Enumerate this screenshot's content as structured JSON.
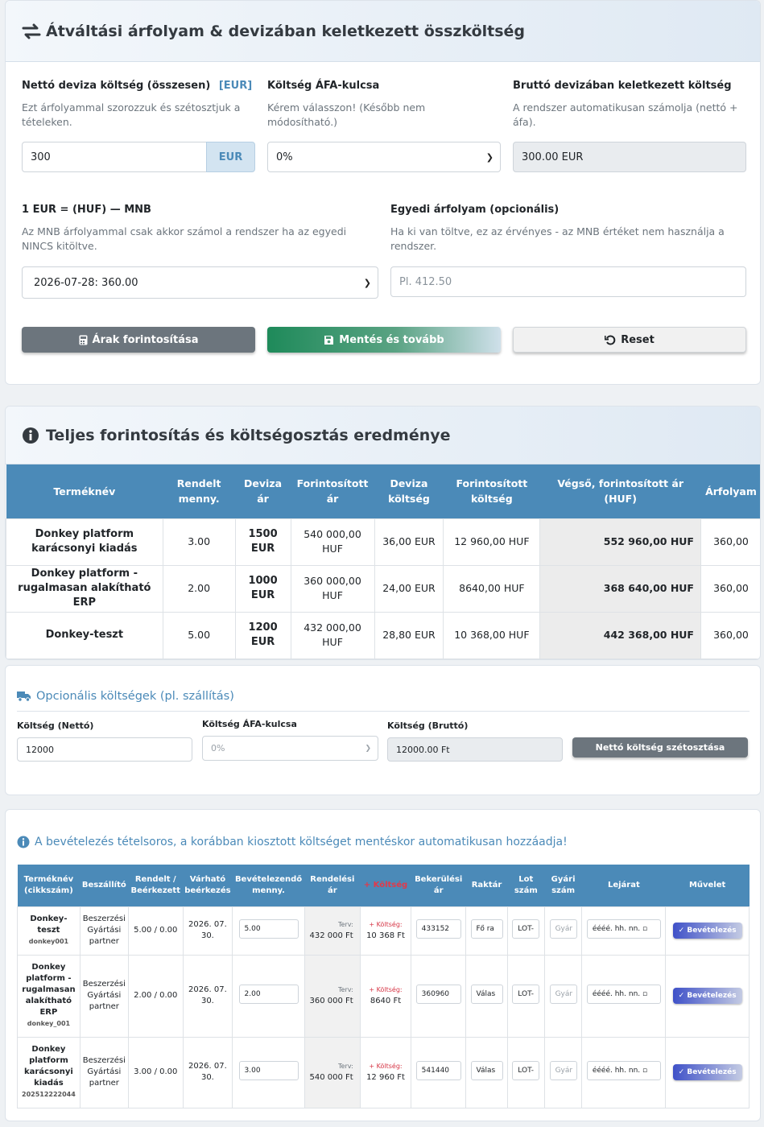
{
  "exchange": {
    "title": "Átváltási árfolyam & devizában keletkezett összköltség",
    "net_label": "Nettó deviza költség (összesen)",
    "net_currency_badge": "[EUR]",
    "net_hint": "Ezt árfolyammal szorozzuk és szétosztjuk a tételeken.",
    "net_value": "300",
    "net_addon": "EUR",
    "vat_label": "Költség ÁFA-kulcsa",
    "vat_hint": "Kérem válasszon! (Később nem módosítható.)",
    "vat_value": "0%",
    "gross_label": "Bruttó devizában keletkezett költség",
    "gross_hint": "A rendszer automatikusan számolja (nettó + áfa).",
    "gross_value": "300.00 EUR",
    "rate_label": "1 EUR = (HUF) — MNB",
    "rate_hint": "Az MNB árfolyammal csak akkor számol a rendszer ha az egyedi NINCS kitöltve.",
    "rate_value": "2026-07-28: 360.00",
    "custom_label": "Egyedi árfolyam (opcionális)",
    "custom_hint": "Ha ki van töltve, ez az érvényes - az MNB értéket nem használja a rendszer.",
    "custom_placeholder": "Pl. 412.50",
    "btn_convert": "Árak forintosítása",
    "btn_save": "Mentés és tovább",
    "btn_reset": "Reset"
  },
  "result": {
    "title": "Teljes forintosítás és költségosztás eredménye",
    "headers": [
      "Terméknév",
      "Rendelt menny.",
      "Deviza ár",
      "Forintosított ár",
      "Deviza költség",
      "Forintosított költség",
      "Végső, forintosított ár (HUF)",
      "Árfolyam"
    ],
    "rows": [
      {
        "name": "Donkey platform karácsonyi kiadás",
        "qty": "3.00",
        "fx_price": "1500 EUR",
        "huf_price": "540 000,00 HUF",
        "fx_cost": "36,00 EUR",
        "huf_cost": "12 960,00 HUF",
        "final": "552 960,00 HUF",
        "rate": "360,00"
      },
      {
        "name": "Donkey platform - rugalmasan alakítható ERP",
        "qty": "2.00",
        "fx_price": "1000 EUR",
        "huf_price": "360 000,00 HUF",
        "fx_cost": "24,00 EUR",
        "huf_cost": "8640,00 HUF",
        "final": "368 640,00 HUF",
        "rate": "360,00"
      },
      {
        "name": "Donkey-teszt",
        "qty": "5.00",
        "fx_price": "1200 EUR",
        "huf_price": "432 000,00 HUF",
        "fx_cost": "28,80 EUR",
        "huf_cost": "10 368,00 HUF",
        "final": "442 368,00 HUF",
        "rate": "360,00"
      }
    ]
  },
  "optional": {
    "title": "Opcionális költségek (pl. szállítás)",
    "net_label": "Költség (Nettó)",
    "net_value": "12000",
    "vat_label": "Költség ÁFA-kulcsa",
    "vat_value": "0%",
    "gross_label": "Költség (Bruttó)",
    "gross_value": "12000.00 Ft",
    "btn_distribute": "Nettó költség szétosztása"
  },
  "receiving": {
    "notice": "A bevételezés tételsoros, a korábban kiosztott költséget mentéskor automatikusan hozzáadja!",
    "headers": [
      "Terméknév (cikkszám)",
      "Beszállító",
      "Rendelt / Beérkezett",
      "Várható beérkezés",
      "Bevételezendő menny.",
      "Rendelési ár",
      "+ Költség",
      "Bekerülési ár",
      "Raktár",
      "Lot szám",
      "Gyári szám",
      "Lejárat",
      "Művelet"
    ],
    "rows": [
      {
        "name": "Donkey-teszt",
        "sku": "donkey001",
        "supplier": "Beszerzési Gyártási partner",
        "ordered": "5.00 / 0.00",
        "expected": "2026. 07. 30.",
        "qty": "5.00",
        "plan_label": "Terv:",
        "plan": "432 000 Ft",
        "cost_label": "+ Költség:",
        "cost": "10 368 Ft",
        "landed": "433152",
        "warehouse": "Fő ra",
        "lot": "LOT-",
        "serial": "Gyár",
        "expiry": "éééé. hh. nn.",
        "action": "Bevételezés"
      },
      {
        "name": "Donkey platform - rugalmasan alakítható ERP",
        "sku": "donkey_001",
        "supplier": "Beszerzési Gyártási partner",
        "ordered": "2.00 / 0.00",
        "expected": "2026. 07. 30.",
        "qty": "2.00",
        "plan_label": "Terv:",
        "plan": "360 000 Ft",
        "cost_label": "+ Költség:",
        "cost": "8640 Ft",
        "landed": "360960",
        "warehouse": "Válas",
        "lot": "LOT-",
        "serial": "Gyár",
        "expiry": "éééé. hh. nn.",
        "action": "Bevételezés"
      },
      {
        "name": "Donkey platform karácsonyi kiadás",
        "sku": "202512222044",
        "supplier": "Beszerzési Gyártási partner",
        "ordered": "3.00 / 0.00",
        "expected": "2026. 07. 30.",
        "qty": "3.00",
        "plan_label": "Terv:",
        "plan": "540 000 Ft",
        "cost_label": "+ Költség:",
        "cost": "12 960 Ft",
        "landed": "541440",
        "warehouse": "Válas",
        "lot": "LOT-",
        "serial": "Gyár",
        "expiry": "éééé. hh. nn.",
        "action": "Bevételezés"
      }
    ]
  },
  "colors": {
    "primary": "#4b8ab8",
    "header_gradient_end": "#dfe9f3",
    "btn_gray": "#6c757d",
    "btn_green": "#1e8a5a",
    "accent_red": "#d63545"
  }
}
